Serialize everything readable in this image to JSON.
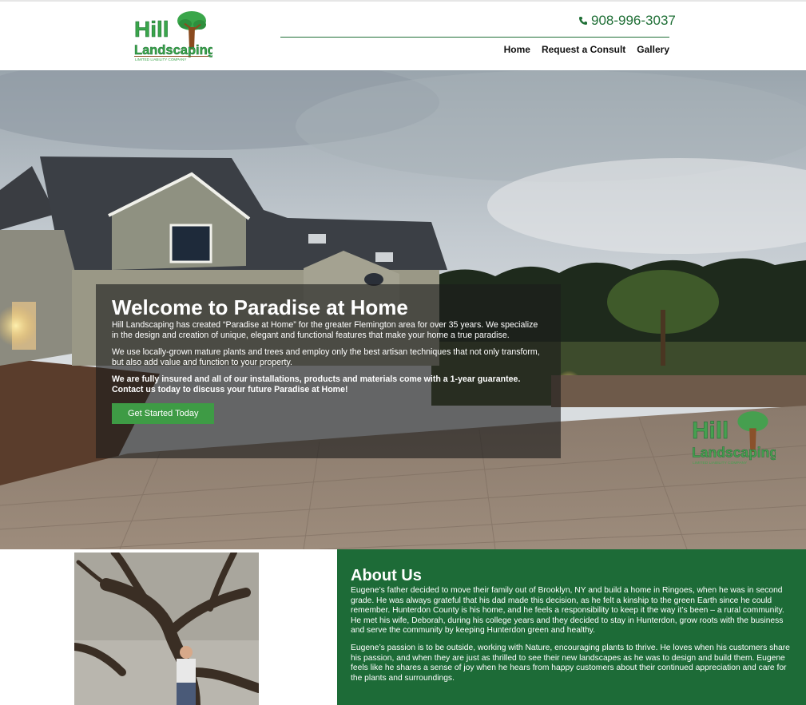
{
  "header": {
    "logo": {
      "name": "Hill Landscaping",
      "line1": "Hill",
      "line2": "Landscaping",
      "tagline": "LIMITED LIABILITY COMPANY"
    },
    "phone": "908-996-3037",
    "nav": [
      "Home",
      "Request a Consult",
      "Gallery"
    ]
  },
  "hero": {
    "title": "Welcome to Paradise at Home",
    "paragraphs": [
      "Hill Landscaping has created “Paradise at Home” for the greater Flemington area for over 35 years. We specialize in the design and creation of unique, elegant and functional features that make your home a true paradise.",
      "We use locally-grown mature plants and trees and employ only the best artisan techniques that not only transform, but also add value and function to your property."
    ],
    "bold_paragraph": "We are fully insured and all of our installations, products and materials come with a 1-year guarantee. Contact us today to discuss your future Paradise at Home!",
    "button_label": "Get Started Today"
  },
  "about": {
    "title": "About Us",
    "paragraphs": [
      "Eugene’s father decided to move their family out of Brooklyn, NY and build a home in Ringoes, when he was in second grade. He was always grateful that his dad made this decision, as he felt a kinship to the green Earth since he could remember. Hunterdon County is his home, and he feels a responsibility to keep it the way it’s been – a rural community. He met his wife, Deborah, during his college years and they decided to stay in Hunterdon, grow roots with the business and serve the community by keeping Hunterdon green and healthy.",
      "Eugene’s passion is to be outside, working with Nature, encouraging plants to thrive. He loves when his customers share his passion, and when they are just as thrilled to see their new landscapes as he was to design and build them. Eugene feels like he shares a sense of joy when he hears from happy customers about their continued appreciation and care for the plants and surroundings."
    ]
  },
  "colors": {
    "brand_green": "#1f6f36",
    "about_green": "#1d6b37",
    "button_green": "#3e9b45",
    "logo_green": "#3aa64a",
    "logo_brown": "#8a4a1e"
  },
  "icons": [
    "phone-icon",
    "tree-logo-icon"
  ]
}
